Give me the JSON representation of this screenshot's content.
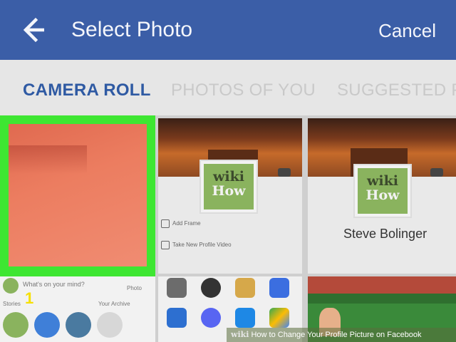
{
  "header": {
    "title": "Select Photo",
    "cancel_label": "Cancel",
    "back_icon": "back-arrow-icon",
    "bg_color": "#3b5ea7"
  },
  "tabs": [
    {
      "label": "CAMERA ROLL",
      "active": true
    },
    {
      "label": "PHOTOS OF YOU",
      "active": false
    },
    {
      "label": "SUGGESTED PI",
      "active": false
    }
  ],
  "grid": {
    "selected_color": "#3ee632",
    "tile2": {
      "logo_top": "wiki",
      "logo_bottom": "How",
      "menu_items": [
        "Add Frame",
        "Take New Profile Video"
      ]
    },
    "tile3": {
      "logo_top": "wiki",
      "logo_bottom": "How",
      "name": "Steve Bolinger"
    },
    "bottom_left": {
      "status_prompt": "What's on your mind?",
      "photo_label": "Photo",
      "stories_label": "Stories",
      "archive_label": "Your Archive",
      "step_number": "1"
    }
  },
  "watermark": {
    "brand": "wiki",
    "text": "How to Change Your Profile Picture on Facebook"
  }
}
